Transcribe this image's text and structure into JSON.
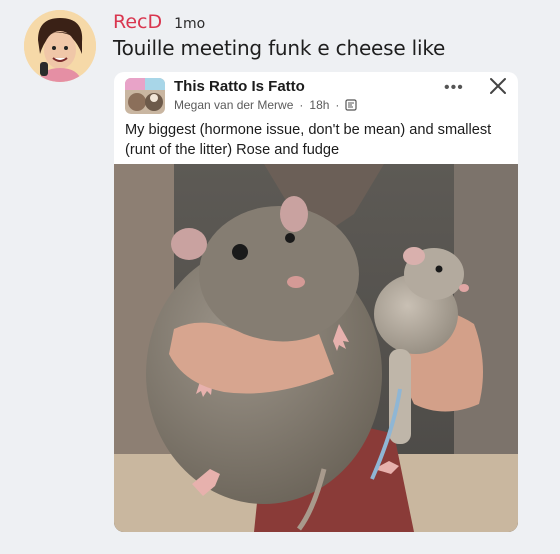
{
  "comment": {
    "username": "RecD",
    "age": "1mo",
    "text": "Touille meeting funk e cheese like"
  },
  "shared_post": {
    "group_name": "This Ratto Is Fatto",
    "author": "Megan van der Merwe",
    "time": "18h",
    "separator": "·",
    "more_label": "•••",
    "text": "My biggest (hormone issue, don't be mean) and smallest (runt of the litter) Rose and fudge"
  },
  "icons": [
    "avatar-icon",
    "globe-icon",
    "more-icon",
    "close-icon"
  ],
  "colors": {
    "username": "#d9364f",
    "background": "#eef0f3",
    "card": "#ffffff"
  }
}
